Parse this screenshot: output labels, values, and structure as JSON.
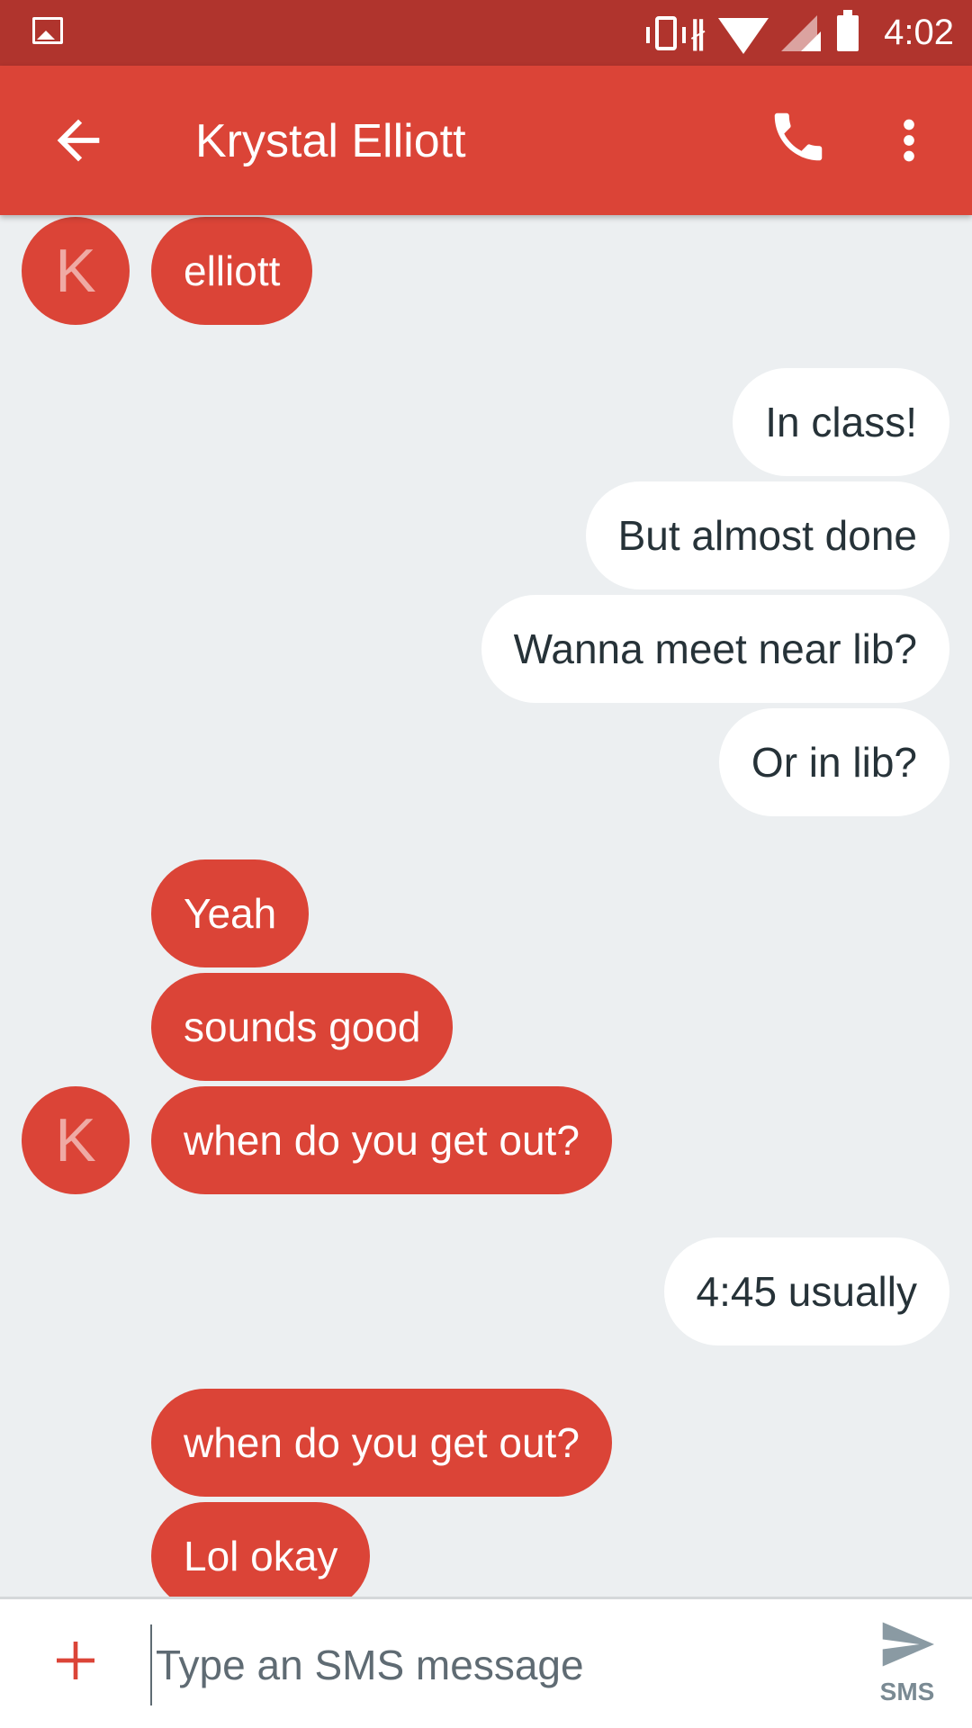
{
  "status_bar": {
    "time": "4:02",
    "icons": [
      "gallery-icon",
      "vibrate-icon",
      "bluetooth-icon",
      "wifi-icon",
      "signal-icon",
      "battery-icon"
    ]
  },
  "app_bar": {
    "title": "Krystal Elliott",
    "icons": [
      "back-arrow-icon",
      "phone-icon",
      "more-vert-icon"
    ],
    "color": "#db4437"
  },
  "conversation": {
    "avatar_letter": "K",
    "incoming_color": "#db4437",
    "outgoing_color": "#ffffff",
    "messages": [
      {
        "direction": "incoming",
        "text": "elliott",
        "avatar": true
      },
      {
        "direction": "outgoing",
        "text": "In class!"
      },
      {
        "direction": "outgoing",
        "text": "But almost done"
      },
      {
        "direction": "outgoing",
        "text": "Wanna meet near lib?"
      },
      {
        "direction": "outgoing",
        "text": "Or in lib?"
      },
      {
        "direction": "incoming",
        "text": "Yeah"
      },
      {
        "direction": "incoming",
        "text": "sounds good"
      },
      {
        "direction": "incoming",
        "text": "when do you get out?",
        "avatar": true
      },
      {
        "direction": "outgoing",
        "text": "4:45 usually"
      },
      {
        "direction": "incoming",
        "text": "when do you get out?"
      },
      {
        "direction": "incoming",
        "text": "Lol okay"
      }
    ]
  },
  "composer": {
    "placeholder": "Type an SMS message",
    "value": "",
    "send_label": "SMS"
  }
}
